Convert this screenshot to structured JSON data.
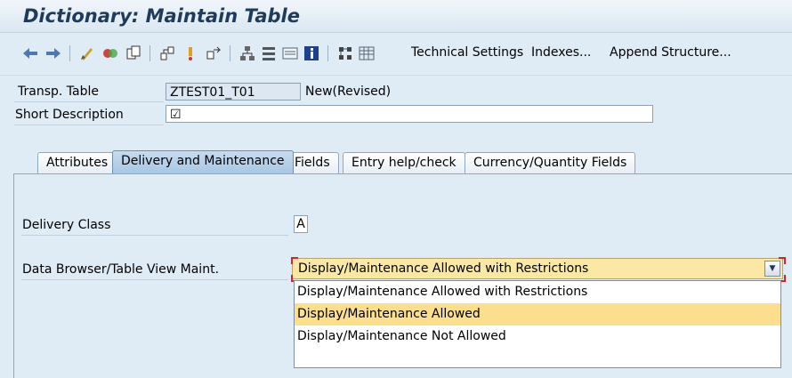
{
  "window": {
    "title": "Dictionary: Maintain Table"
  },
  "toolbar": {
    "icons": [
      "back-arrow-icon",
      "forward-arrow-icon",
      "edit-pencil-icon",
      "activate-icon",
      "copy-icon",
      "where-used-icon",
      "pin-icon",
      "navigate-icon",
      "hierarchy-icon",
      "list-icon",
      "display-icon",
      "info-icon",
      "graph-icon",
      "table-icon"
    ],
    "technical_settings": "Technical Settings",
    "indexes": "Indexes...",
    "append_structure": "Append Structure..."
  },
  "header": {
    "transp_table_label": "Transp. Table",
    "transp_table_value": "ZTEST01_T01",
    "status": "New(Revised)",
    "short_desc_label": "Short Description",
    "short_desc_value": "☑"
  },
  "tabs": [
    {
      "label": "Attributes"
    },
    {
      "label": "Delivery and Maintenance"
    },
    {
      "label": "Fields"
    },
    {
      "label": "Entry help/check"
    },
    {
      "label": "Currency/Quantity Fields"
    }
  ],
  "delivery": {
    "class_label": "Delivery Class",
    "class_value": "A",
    "browser_label": "Data Browser/Table View Maint.",
    "browser_value": "Display/Maintenance Allowed with Restrictions",
    "options": [
      "Display/Maintenance Allowed with Restrictions",
      "Display/Maintenance Allowed",
      "Display/Maintenance Not Allowed"
    ]
  },
  "colors": {
    "accent": "#fbdf8c",
    "title": "#1f3b5b",
    "background": "#dfebf5"
  }
}
